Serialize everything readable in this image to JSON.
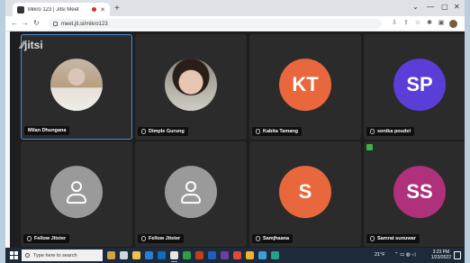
{
  "browser": {
    "tab_title": "Mikro 123 | Jitsi Meet",
    "new_tab": "+",
    "url": "meet.jit.si/mikro123",
    "window_controls": [
      "⌄",
      "—",
      "▢",
      "✕"
    ]
  },
  "meeting": {
    "logo": "jitsi",
    "participants": [
      {
        "name": "Milan Dhungana",
        "initials": "",
        "kind": "photo1",
        "color": "#d9c6b6"
      },
      {
        "name": "Dimple Gurung",
        "initials": "",
        "kind": "photo2",
        "color": "#2a1e19"
      },
      {
        "name": "Kabita Tamang",
        "initials": "KT",
        "kind": "initials",
        "color": "#e8673c"
      },
      {
        "name": "sonika poudel",
        "initials": "SP",
        "kind": "initials",
        "color": "#5b3ed8"
      },
      {
        "name": "Fellow Jitster",
        "initials": "",
        "kind": "placeholder",
        "color": "#9a9a9a"
      },
      {
        "name": "Fellow Jitster",
        "initials": "",
        "kind": "placeholder",
        "color": "#9a9a9a"
      },
      {
        "name": "Samjhaana",
        "initials": "S",
        "kind": "initials",
        "color": "#e8673c"
      },
      {
        "name": "Samrat sunuwar",
        "initials": "SS",
        "kind": "initials",
        "color": "#b0317b"
      }
    ]
  },
  "taskbar": {
    "search_placeholder": "Type here to search",
    "weather": "21°F",
    "time": "3:23 PM",
    "date": "1/23/2022"
  },
  "colors": {
    "accent": "#4a8fd9",
    "stage_bg": "#1e1e1e",
    "tile_bg": "#2b2b2b"
  }
}
